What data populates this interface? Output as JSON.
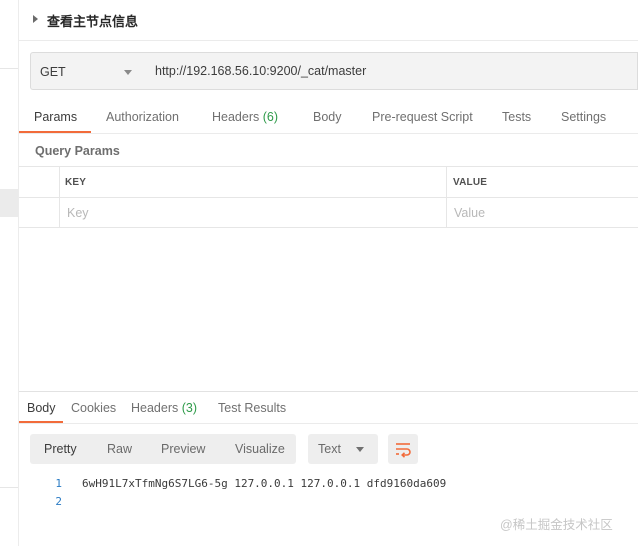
{
  "request": {
    "title": "查看主节点信息",
    "method": "GET",
    "url": "http://192.168.56.10:9200/_cat/master"
  },
  "request_tabs": [
    {
      "label": "Params",
      "active": true
    },
    {
      "label": "Authorization"
    },
    {
      "label": "Headers",
      "count": "(6)"
    },
    {
      "label": "Body"
    },
    {
      "label": "Pre-request Script"
    },
    {
      "label": "Tests"
    },
    {
      "label": "Settings"
    }
  ],
  "query_params": {
    "label": "Query Params",
    "columns": [
      "KEY",
      "VALUE"
    ],
    "placeholders": {
      "key": "Key",
      "value": "Value"
    }
  },
  "response_tabs": [
    {
      "label": "Body",
      "active": true
    },
    {
      "label": "Cookies"
    },
    {
      "label": "Headers",
      "count": "(3)"
    },
    {
      "label": "Test Results"
    }
  ],
  "view_modes": [
    "Pretty",
    "Raw",
    "Preview",
    "Visualize"
  ],
  "active_view_mode": "Pretty",
  "format": "Text",
  "response_lines": [
    {
      "no": "1",
      "text": "6wH91L7xTfmNg6S7LG6-5g 127.0.0.1 127.0.0.1 dfd9160da609"
    },
    {
      "no": "2",
      "text": ""
    }
  ],
  "watermark": "@稀土掘金技术社区",
  "icons": {
    "wrap": "wrap-lines-icon",
    "caret": "caret-right-icon",
    "dropdown": "chevron-down-icon"
  },
  "colors": {
    "accent": "#f26b3a",
    "count_green": "#2f9b4a",
    "line_number": "#2a7bc4"
  }
}
